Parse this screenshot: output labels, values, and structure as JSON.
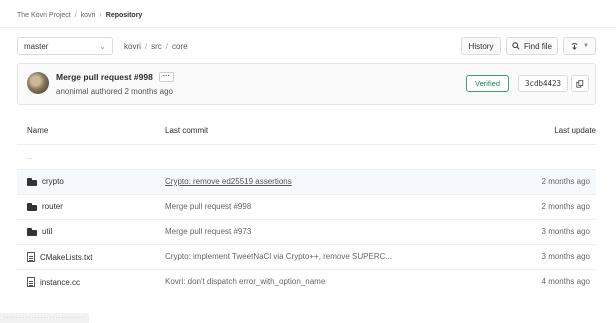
{
  "breadcrumb": {
    "items": [
      "The Kovri Project",
      "kovri"
    ],
    "current": "Repository",
    "separator": "/"
  },
  "toolbar": {
    "branch": "master",
    "path": [
      "kovri",
      "src",
      "core"
    ],
    "path_separator": "/",
    "history_label": "History",
    "find_file_label": "Find file",
    "icons": {
      "branch_dropdown": "chevron-down-icon",
      "find": "search-icon",
      "clone": "download-icon"
    }
  },
  "commit": {
    "title": "Merge pull request #998",
    "more_label": "···",
    "author_line": "anonimal authored 2 months ago",
    "verified_label": "Verified",
    "sha": "3cdb4423",
    "colors": {
      "verified": "#1d8a53"
    }
  },
  "table": {
    "headers": {
      "name": "Name",
      "last_commit": "Last commit",
      "last_update": "Last update"
    },
    "parent_row": "..",
    "rows": [
      {
        "type": "folder",
        "name": "crypto",
        "message": "Crypto: remove ed25519 assertions",
        "date": "2 months ago"
      },
      {
        "type": "folder",
        "name": "router",
        "message": "Merge pull request #998",
        "date": "2 months ago"
      },
      {
        "type": "folder",
        "name": "util",
        "message": "Merge pull request #973",
        "date": "3 months ago"
      },
      {
        "type": "file",
        "name": "CMakeLists.txt",
        "message": "Crypto: implement TweetNaCl via Crypto++, remove SUPERC...",
        "date": "3 months ago"
      },
      {
        "type": "file",
        "name": "instance.cc",
        "message": "Kovri: don't dispatch error_with_option_name",
        "date": "4 months ago"
      }
    ]
  },
  "status_tip": "· · · · · · · · · · · · · · · · · · · · · · · · · · ·"
}
